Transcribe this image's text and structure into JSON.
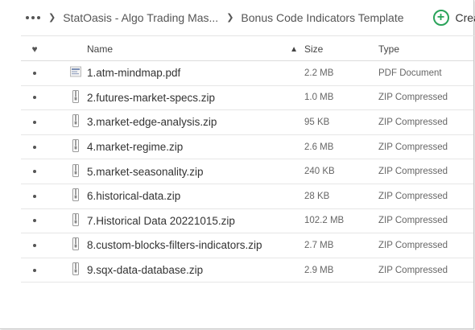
{
  "breadcrumb": {
    "items": [
      "StatOasis - Algo Trading Mas...",
      "Bonus Code Indicators Template"
    ],
    "create_label": "Create fo"
  },
  "table": {
    "columns": {
      "name": "Name",
      "size": "Size",
      "type": "Type"
    },
    "rows": [
      {
        "name": "1.atm-mindmap.pdf",
        "size": "2.2 MB",
        "type": "PDF Document",
        "icon": "pdf-file-icon"
      },
      {
        "name": "2.futures-market-specs.zip",
        "size": "1.0 MB",
        "type": "ZIP Compressed",
        "icon": "zip-file-icon"
      },
      {
        "name": "3.market-edge-analysis.zip",
        "size": "95 KB",
        "type": "ZIP Compressed",
        "icon": "zip-file-icon"
      },
      {
        "name": "4.market-regime.zip",
        "size": "2.6 MB",
        "type": "ZIP Compressed",
        "icon": "zip-file-icon"
      },
      {
        "name": "5.market-seasonality.zip",
        "size": "240 KB",
        "type": "ZIP Compressed",
        "icon": "zip-file-icon"
      },
      {
        "name": "6.historical-data.zip",
        "size": "28 KB",
        "type": "ZIP Compressed",
        "icon": "zip-file-icon"
      },
      {
        "name": "7.Historical Data 20221015.zip",
        "size": "102.2 MB",
        "type": "ZIP Compressed",
        "icon": "zip-file-icon"
      },
      {
        "name": "8.custom-blocks-filters-indicators.zip",
        "size": "2.7 MB",
        "type": "ZIP Compressed",
        "icon": "zip-file-icon"
      },
      {
        "name": "9.sqx-data-database.zip",
        "size": "2.9 MB",
        "type": "ZIP Compressed",
        "icon": "zip-file-icon"
      }
    ]
  },
  "colors": {
    "accent_green": "#2aa35a"
  }
}
